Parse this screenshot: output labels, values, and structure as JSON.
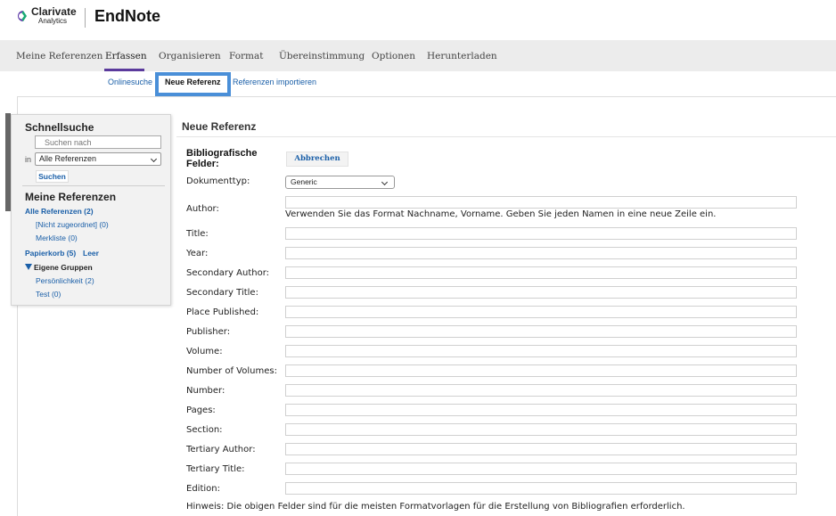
{
  "brand": {
    "name_line1": "Clarivate",
    "name_line2": "Analytics",
    "app_title": "EndNote"
  },
  "nav": {
    "tabs": [
      {
        "label": "Meine Referenzen"
      },
      {
        "label": "Erfassen",
        "active": true
      },
      {
        "label": "Organisieren"
      },
      {
        "label": "Format"
      },
      {
        "label": "Übereinstimmung"
      },
      {
        "label": "Optionen"
      },
      {
        "label": "Herunterladen"
      }
    ],
    "subtabs": [
      {
        "label": "Onlinesuche"
      },
      {
        "label": "Neue Referenz",
        "active": true
      },
      {
        "label": "Referenzen importieren"
      }
    ]
  },
  "sidebar": {
    "quick_search_title": "Schnellsuche",
    "search_placeholder": "Suchen nach",
    "in_label": "in",
    "scope_value": "Alle Referenzen",
    "search_button": "Suchen",
    "my_refs_title": "Meine Referenzen",
    "all_refs": "Alle Referenzen (2)",
    "unfiled": "[Nicht zugeordnet] (0)",
    "watchlist": "Merkliste (0)",
    "trash": "Papierkorb (5)",
    "empty": "Leer",
    "groups_title": "Eigene Gruppen",
    "groups": [
      "Persönlichkeit (2)",
      "Test (0)"
    ]
  },
  "form": {
    "title": "Neue Referenz",
    "bib_label": "Bibliografische Felder:",
    "cancel_button": "Abbrechen",
    "doctype_label": "Dokumenttyp:",
    "doctype_value": "Generic",
    "author_hint": "Verwenden Sie das Format Nachname, Vorname. Geben Sie jeden Namen in eine neue Zeile ein.",
    "fields": [
      "Author:",
      "Title:",
      "Year:",
      "Secondary Author:",
      "Secondary Title:",
      "Place Published:",
      "Publisher:",
      "Volume:",
      "Number of Volumes:",
      "Number:",
      "Pages:",
      "Section:",
      "Tertiary Author:",
      "Tertiary Title:",
      "Edition:"
    ],
    "footer_hint": "Hinweis: Die obigen Felder sind für die meisten Formatvorlagen für die Erstellung von Bibliografien erforderlich."
  },
  "colors": {
    "accent": "#5b3a9c",
    "link": "#1a5fa8",
    "highlight": "#4a8fd8"
  }
}
